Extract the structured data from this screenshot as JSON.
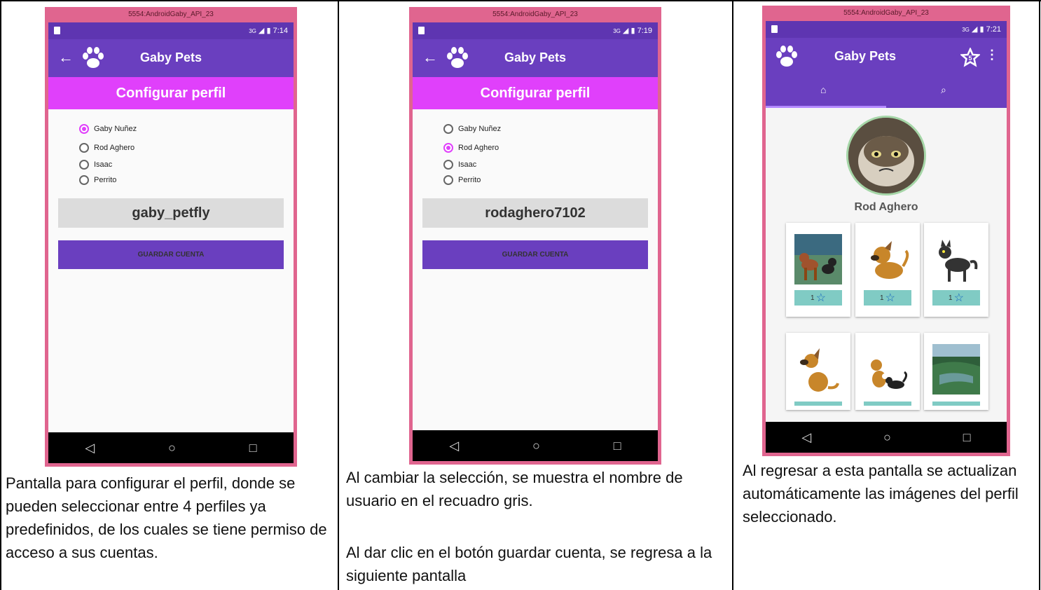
{
  "emulator_title": "5554:AndroidGaby_API_23",
  "app": {
    "title": "Gaby Pets",
    "screen_title": "Configurar perfil",
    "save_button": "GUARDAR CUENTA",
    "profiles": [
      "Gaby Nuñez",
      "Rod Aghero",
      "Isaac",
      "Perrito"
    ]
  },
  "panel1": {
    "time": "7:14",
    "signal": "3G",
    "selected_profile": "Gaby Nuñez",
    "username": "gaby_petfly",
    "caption": "Pantalla para configurar el perfil, donde se pueden seleccionar entre 4 perfiles ya predefinidos, de los cuales se tiene permiso de acceso a sus cuentas."
  },
  "panel2": {
    "time": "7:19",
    "signal": "3G",
    "selected_profile": "Rod Aghero",
    "username": "rodaghero7102",
    "caption_1": "Al cambiar la selección, se muestra el nombre de usuario en el recuadro gris.",
    "caption_2": "Al dar clic en el botón guardar cuenta, se regresa a la siguiente pantalla"
  },
  "panel3": {
    "time": "7:21",
    "signal": "3G",
    "favorites_badge": "5",
    "profile_name": "Rod Aghero",
    "cards": [
      {
        "rating": "1",
        "image": "dog-and-cat-scene"
      },
      {
        "rating": "1",
        "image": "cartoon-dog"
      },
      {
        "rating": "1",
        "image": "cartoon-cat"
      },
      {
        "rating": "",
        "image": "sitting-dog"
      },
      {
        "rating": "",
        "image": "dog-and-cat"
      },
      {
        "rating": "",
        "image": "landscape"
      }
    ],
    "caption": "Al regresar a esta pantalla se actualizan automáticamente las imágenes del perfil seleccionado."
  },
  "icons": {
    "back": "arrow-left-icon",
    "logo": "paw-icon",
    "home_tab": "home-icon",
    "search_tab": "search-icon",
    "favorites": "star-icon",
    "overflow": "more-vert-icon",
    "nav_back": "triangle-back-icon",
    "nav_home": "circle-home-icon",
    "nav_recents": "square-recents-icon"
  },
  "colors": {
    "primary": "#6a3fbf",
    "accent": "#e040fb",
    "emulator_frame": "#e0658f"
  }
}
